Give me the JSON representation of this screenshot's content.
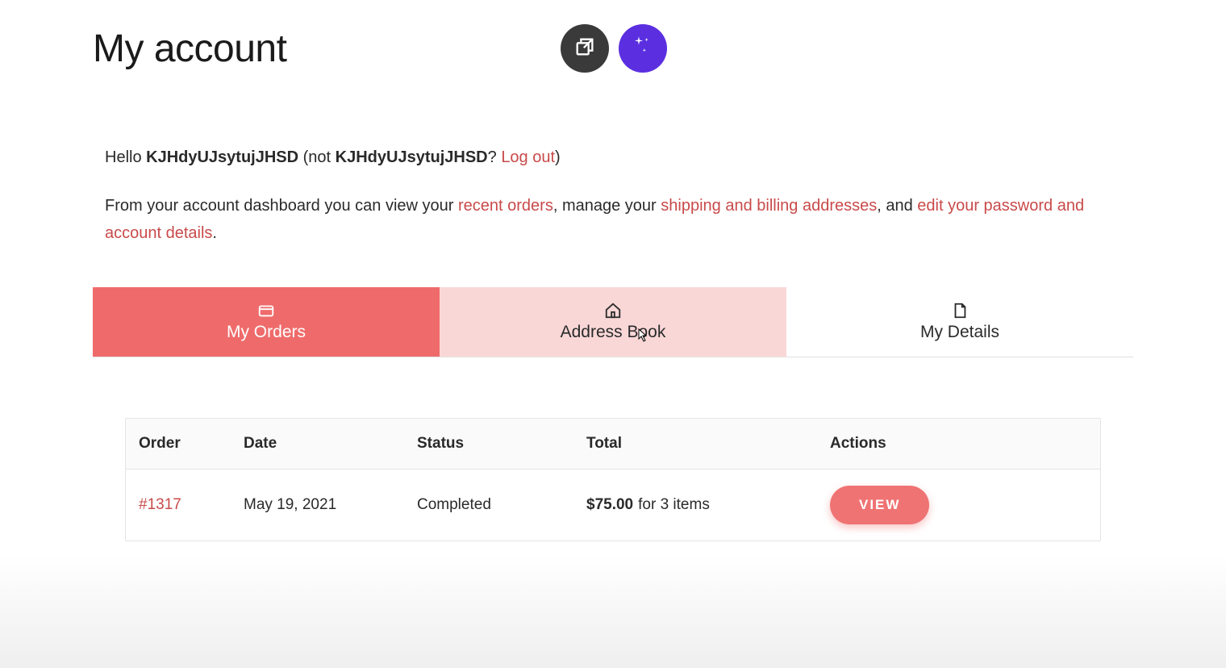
{
  "header": {
    "title": "My account"
  },
  "greeting": {
    "prefix": "Hello ",
    "username": "KJHdyUJsytujJHSD",
    "not_prefix": " (not ",
    "not_username": "KJHdyUJsytujJHSD",
    "question": "? ",
    "logout": "Log out",
    "closing": ")"
  },
  "dashboard": {
    "p1": "From your account dashboard you can view your ",
    "link_orders": "recent orders",
    "p2": ", manage your ",
    "link_addresses": "shipping and billing addresses",
    "p3": ", and ",
    "link_details": "edit your password and account details",
    "p4": "."
  },
  "tabs": {
    "my_orders": "My Orders",
    "address_book": "Address Book",
    "my_details": "My Details"
  },
  "table": {
    "headers": {
      "order": "Order",
      "date": "Date",
      "status": "Status",
      "total": "Total",
      "actions": "Actions"
    },
    "rows": [
      {
        "order": "#1317",
        "date": "May 19, 2021",
        "status": "Completed",
        "total_amount": "$75.00",
        "total_suffix": " for 3 items",
        "action_label": "VIEW"
      }
    ]
  }
}
